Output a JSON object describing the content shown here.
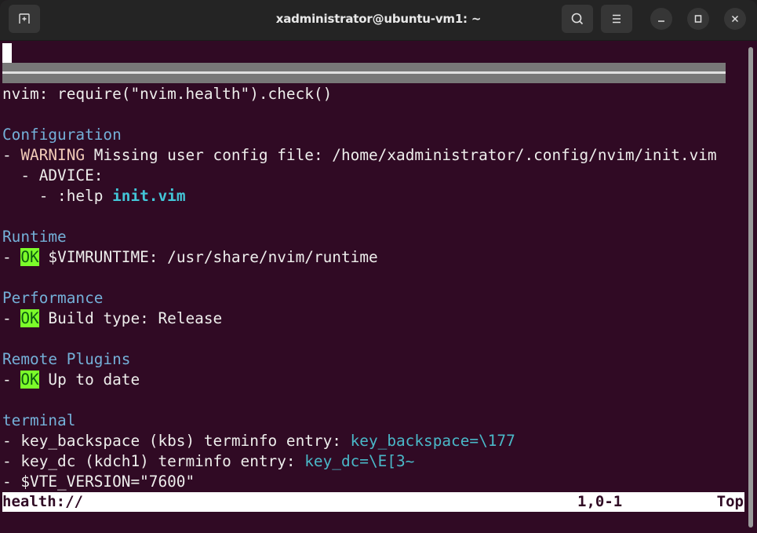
{
  "window": {
    "title": "xadministrator@ubuntu-vm1: ~",
    "buttons": {
      "new_tab": "new-tab-icon",
      "search": "search-icon",
      "menu": "hamburger-menu-icon",
      "minimize": "minimize-icon",
      "maximize": "maximize-icon",
      "close": "close-icon"
    }
  },
  "terminal": {
    "command": "nvim: require(\"nvim.health\").check()",
    "sections": {
      "configuration": {
        "title": "Configuration",
        "warning_prefix": "- ",
        "warning_label": "WARNING",
        "warning_text": " Missing user config file: /home/xadministrator/.config/nvim/init.vim",
        "advice": "  - ADVICE:",
        "help_prefix": "    - :help ",
        "help_link": "init.vim"
      },
      "runtime": {
        "title": "Runtime",
        "prefix": "- ",
        "status": "OK",
        "text": " $VIMRUNTIME: /usr/share/nvim/runtime"
      },
      "performance": {
        "title": "Performance",
        "prefix": "- ",
        "status": "OK",
        "text": " Build type: Release"
      },
      "remote_plugins": {
        "title": "Remote Plugins",
        "prefix": "- ",
        "status": "OK",
        "text": " Up to date"
      },
      "terminal": {
        "title": "terminal",
        "line1_text": "- key_backspace (kbs) terminfo entry: ",
        "line1_value": "key_backspace=\\177",
        "line2_text": "- key_dc (kdch1) terminfo entry: ",
        "line2_value": "key_dc=\\E[3~",
        "line3_text": "- $VTE_VERSION=\"7600\""
      }
    },
    "statusline": {
      "buffer": "health://",
      "position": "1,0-1",
      "scroll": "Top"
    }
  },
  "colors": {
    "background": "#300a24",
    "ok_bg": "#7cfc2a",
    "header": "#74b0d8"
  }
}
